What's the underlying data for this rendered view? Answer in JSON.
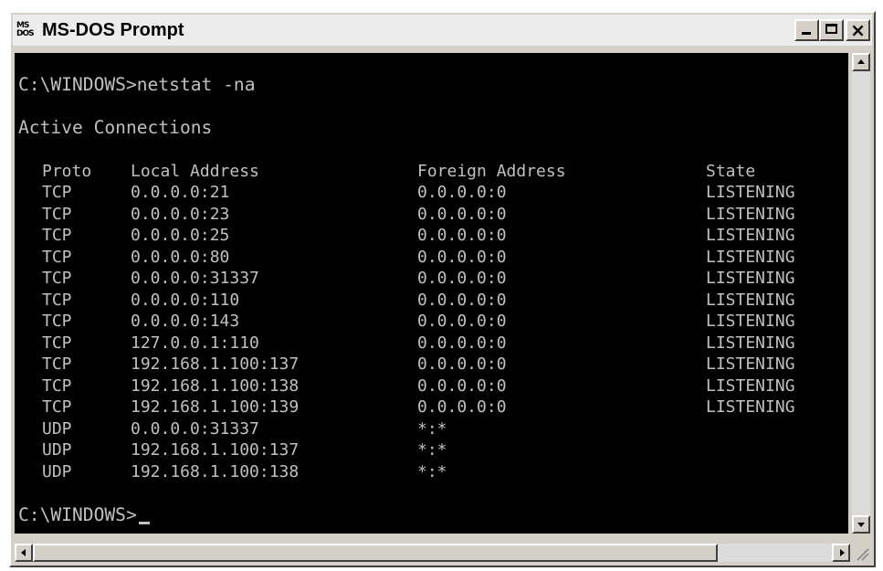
{
  "window": {
    "title": "MS-DOS Prompt",
    "icon_label_top": "MS",
    "icon_label_bottom": "DOS",
    "controls": [
      "minimize-icon",
      "maximize-icon",
      "close-icon"
    ],
    "close_glyph": "×"
  },
  "console": {
    "command_line": "C:\\WINDOWS>netstat -na",
    "heading": "Active Connections",
    "columns": [
      "Proto",
      "Local Address",
      "Foreign Address",
      "State"
    ],
    "rows": [
      [
        "TCP",
        "0.0.0.0:21",
        "0.0.0.0:0",
        "LISTENING"
      ],
      [
        "TCP",
        "0.0.0.0:23",
        "0.0.0.0:0",
        "LISTENING"
      ],
      [
        "TCP",
        "0.0.0.0:25",
        "0.0.0.0:0",
        "LISTENING"
      ],
      [
        "TCP",
        "0.0.0.0:80",
        "0.0.0.0:0",
        "LISTENING"
      ],
      [
        "TCP",
        "0.0.0.0:31337",
        "0.0.0.0:0",
        "LISTENING"
      ],
      [
        "TCP",
        "0.0.0.0:110",
        "0.0.0.0:0",
        "LISTENING"
      ],
      [
        "TCP",
        "0.0.0.0:143",
        "0.0.0.0:0",
        "LISTENING"
      ],
      [
        "TCP",
        "127.0.0.1:110",
        "0.0.0.0:0",
        "LISTENING"
      ],
      [
        "TCP",
        "192.168.1.100:137",
        "0.0.0.0:0",
        "LISTENING"
      ],
      [
        "TCP",
        "192.168.1.100:138",
        "0.0.0.0:0",
        "LISTENING"
      ],
      [
        "TCP",
        "192.168.1.100:139",
        "0.0.0.0:0",
        "LISTENING"
      ],
      [
        "UDP",
        "0.0.0.0:31337",
        "*:*",
        ""
      ],
      [
        "UDP",
        "192.168.1.100:137",
        "*:*",
        ""
      ],
      [
        "UDP",
        "192.168.1.100:138",
        "*:*",
        ""
      ]
    ],
    "prompt": "C:\\WINDOWS>"
  },
  "scrollbars": {
    "vertical": [
      "scroll-up-arrow-icon",
      "scroll-down-arrow-icon"
    ],
    "horizontal": [
      "scroll-left-arrow-icon",
      "scroll-right-arrow-icon"
    ]
  }
}
